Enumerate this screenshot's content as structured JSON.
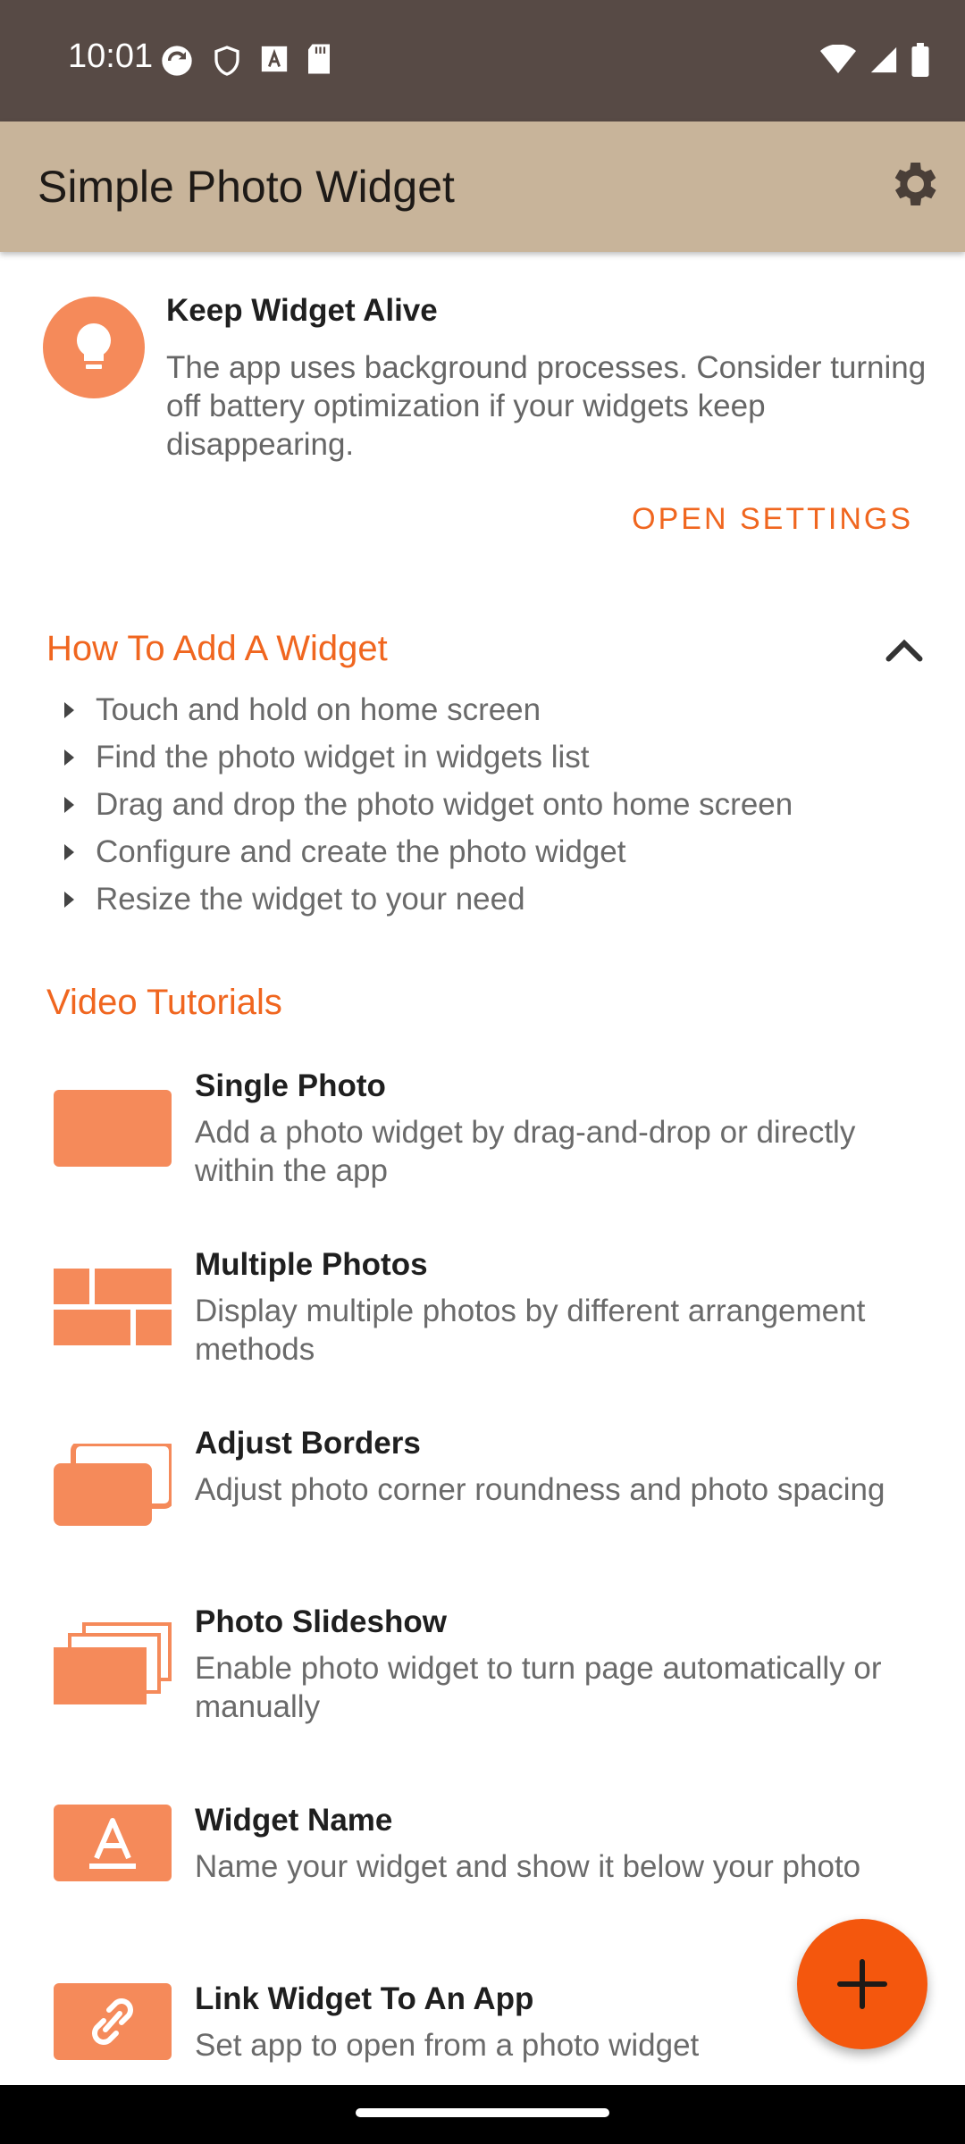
{
  "status": {
    "time": "10:01"
  },
  "appbar": {
    "title": "Simple Photo Widget"
  },
  "tip": {
    "title": "Keep Widget Alive",
    "text": "The app uses background processes. Consider turning off battery optimization if your widgets keep disappearing.",
    "action": "OPEN SETTINGS",
    "icon": "lightbulb-icon"
  },
  "howto": {
    "title": "How To Add A Widget",
    "steps": [
      "Touch and hold on home screen",
      "Find the photo widget in widgets list",
      "Drag and drop the photo widget onto home screen",
      "Configure and create the photo widget",
      "Resize the widget to your need"
    ]
  },
  "tutorials": {
    "title": "Video Tutorials",
    "items": [
      {
        "title": "Single Photo",
        "desc": "Add a photo widget by drag-and-drop or directly within the app",
        "icon": "single-photo-icon"
      },
      {
        "title": "Multiple Photos",
        "desc": "Display multiple photos by different arrangement methods",
        "icon": "multiple-photos-icon"
      },
      {
        "title": "Adjust Borders",
        "desc": "Adjust photo corner roundness and photo spacing",
        "icon": "borders-icon"
      },
      {
        "title": "Photo Slideshow",
        "desc": "Enable photo widget to turn page automatically or manually",
        "icon": "slideshow-icon"
      },
      {
        "title": "Widget Name",
        "desc": "Name your widget and show it below your photo",
        "icon": "text-icon"
      },
      {
        "title": "Link Widget To An App",
        "desc": "Set app to open from a photo widget",
        "icon": "link-icon"
      }
    ]
  },
  "colors": {
    "accent": "#f0661f",
    "fab": "#f4570d",
    "icon": "#f58a5a",
    "appbar": "#c8b49a",
    "statusbar": "#574a45"
  }
}
